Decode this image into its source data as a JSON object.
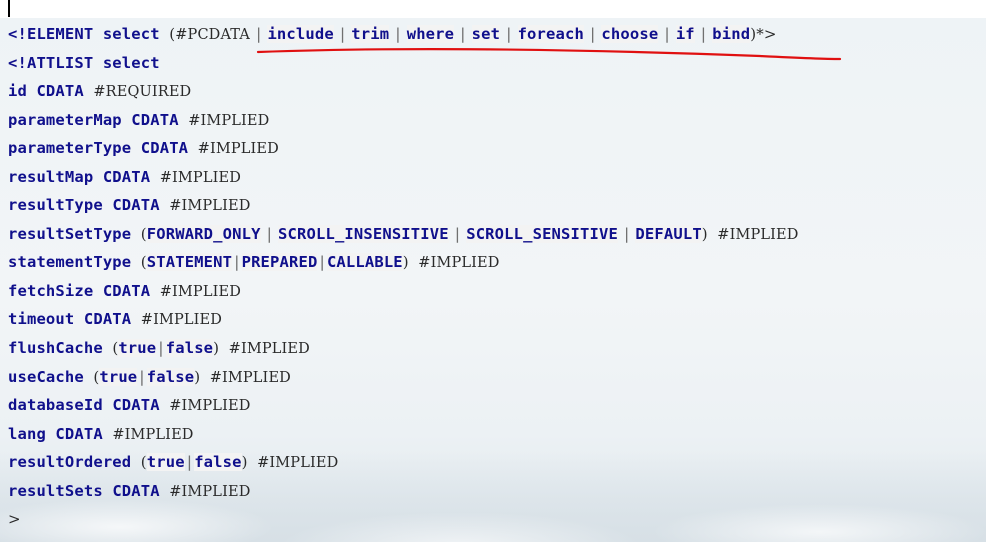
{
  "code": {
    "element_decl": {
      "open": "<!ELEMENT",
      "name": "select",
      "paren_open": "(",
      "pcdata": "#PCDATA",
      "children": [
        "include",
        "trim",
        "where",
        "set",
        "foreach",
        "choose",
        "if",
        "bind"
      ],
      "separator": "|",
      "close": ")*>"
    },
    "attlist_decl": {
      "open": "<!ATTLIST",
      "name": "select"
    },
    "attributes": [
      {
        "name": "id",
        "type": "CDATA",
        "default": "#REQUIRED"
      },
      {
        "name": "parameterMap",
        "type": "CDATA",
        "default": "#IMPLIED"
      },
      {
        "name": "parameterType",
        "type": "CDATA",
        "default": "#IMPLIED"
      },
      {
        "name": "resultMap",
        "type": "CDATA",
        "default": "#IMPLIED"
      },
      {
        "name": "resultType",
        "type": "CDATA",
        "default": "#IMPLIED"
      },
      {
        "name": "resultSetType",
        "options": [
          "FORWARD_ONLY",
          "SCROLL_INSENSITIVE",
          "SCROLL_SENSITIVE",
          "DEFAULT"
        ],
        "spaced": true,
        "default": "#IMPLIED"
      },
      {
        "name": "statementType",
        "options": [
          "STATEMENT",
          "PREPARED",
          "CALLABLE"
        ],
        "spaced": false,
        "default": "#IMPLIED"
      },
      {
        "name": "fetchSize",
        "type": "CDATA",
        "default": "#IMPLIED"
      },
      {
        "name": "timeout",
        "type": "CDATA",
        "default": "#IMPLIED"
      },
      {
        "name": "flushCache",
        "options": [
          "true",
          "false"
        ],
        "spaced": false,
        "default": "#IMPLIED"
      },
      {
        "name": "useCache",
        "options": [
          "true",
          "false"
        ],
        "spaced": false,
        "default": "#IMPLIED"
      },
      {
        "name": "databaseId",
        "type": "CDATA",
        "default": "#IMPLIED"
      },
      {
        "name": "lang",
        "type": "CDATA",
        "default": "#IMPLIED"
      },
      {
        "name": "resultOrdered",
        "options": [
          "true",
          "false"
        ],
        "spaced": false,
        "default": "#IMPLIED"
      },
      {
        "name": "resultSets",
        "type": "CDATA",
        "default": "#IMPLIED"
      }
    ],
    "attlist_close": ">"
  },
  "annotation": {
    "color": "#e01010"
  }
}
